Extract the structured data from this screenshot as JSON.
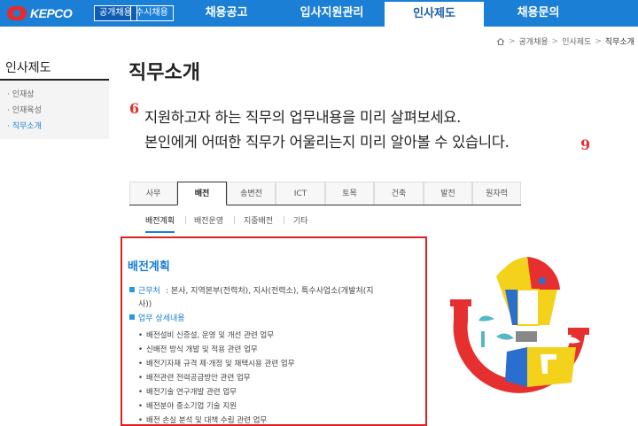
{
  "header": {
    "logo_text": "KEPCO",
    "hire_tabs": [
      "공개채용",
      "수시채용"
    ],
    "nav": [
      "채용공고",
      "입사지원관리",
      "인사제도",
      "채용문의"
    ],
    "active_nav": "인사제도"
  },
  "breadcrumb": {
    "items": [
      "공개채용",
      "인사제도",
      "직무소개"
    ]
  },
  "sidebar": {
    "title": "인사제도",
    "items": [
      "인재상",
      "인재육성",
      "직무소개"
    ],
    "active": "직무소개"
  },
  "page": {
    "title": "직무소개",
    "intro_line1": "지원하고자 하는 직무의 업무내용을 미리 살펴보세요.",
    "intro_line2": "본인에게 어떠한 직무가 어울리는지 미리 알아볼 수 있습니다."
  },
  "job_tabs": [
    "사무",
    "배전",
    "송변전",
    "ICT",
    "토목",
    "건축",
    "발전",
    "원자력"
  ],
  "active_job_tab": "배전",
  "sub_tabs": [
    "배전계획",
    "배전운영",
    "지중배전",
    "기타"
  ],
  "active_sub_tab": "배전계획",
  "content": {
    "heading": "배전계획",
    "workplace_label": "근무처",
    "workplace_value": ": 본사, 지역본부(전력처), 지사(전력소), 특수사업소(개발처(지",
    "workplace_value_cont": "사))",
    "duties_label": "업무 상세내용",
    "duties": [
      "배전설비 신증설, 운영 및 개선 관련 업무",
      "신배전 방식 개발 및 적용 관련 업무",
      "배전기자재 규격 제·개정 및 채택시용 관련 업무",
      "배전관련 전력공급방안 관련 업무",
      "배전기술 연구개발 관련 업무",
      "배전분야 중소기업 기술 지원",
      "배전 손실 분석 및 대책 수립 관련 업무"
    ]
  },
  "colors": {
    "brand_blue": "#1b7fd6",
    "accent_red": "#e02020",
    "illus_yellow": "#f4d21c",
    "illus_red": "#e63030",
    "illus_blue": "#2a6fd0",
    "illus_teal": "#56b8c4"
  }
}
